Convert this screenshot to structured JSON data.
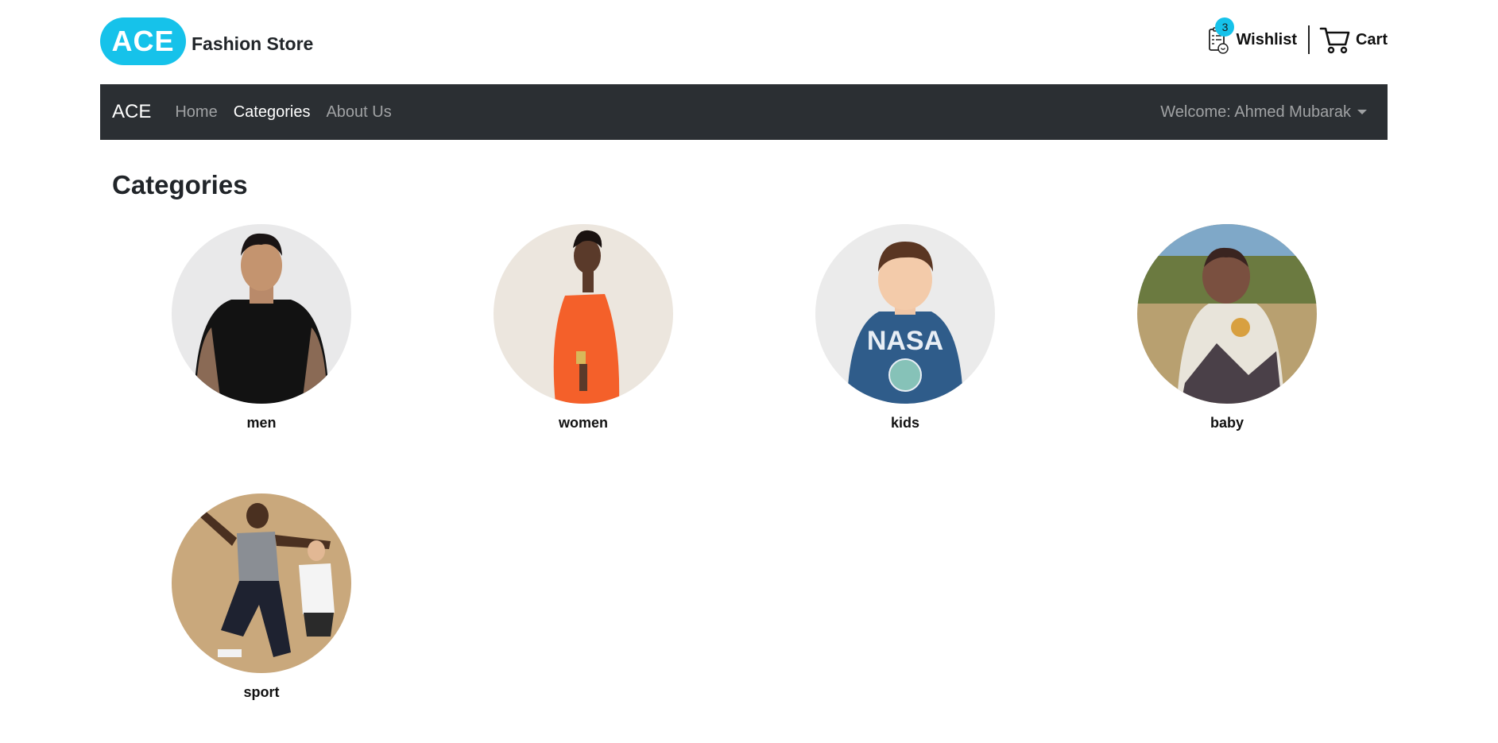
{
  "header": {
    "logo_text": "ACE",
    "store_name": "Fashion Store",
    "wishlist_count": "3",
    "wishlist_label": "Wishlist",
    "cart_label": "Cart",
    "accent_color": "#16c2ea"
  },
  "navbar": {
    "brand": "ACE",
    "links": [
      {
        "label": "Home",
        "active": false
      },
      {
        "label": "Categories",
        "active": true
      },
      {
        "label": "About Us",
        "active": false
      }
    ],
    "user_menu": "Welcome: Ahmed Mubarak",
    "background": "#2b2f33"
  },
  "main": {
    "title": "Categories",
    "categories": [
      {
        "label": "men"
      },
      {
        "label": "women"
      },
      {
        "label": "kids"
      },
      {
        "label": "baby"
      },
      {
        "label": "sport"
      }
    ]
  }
}
